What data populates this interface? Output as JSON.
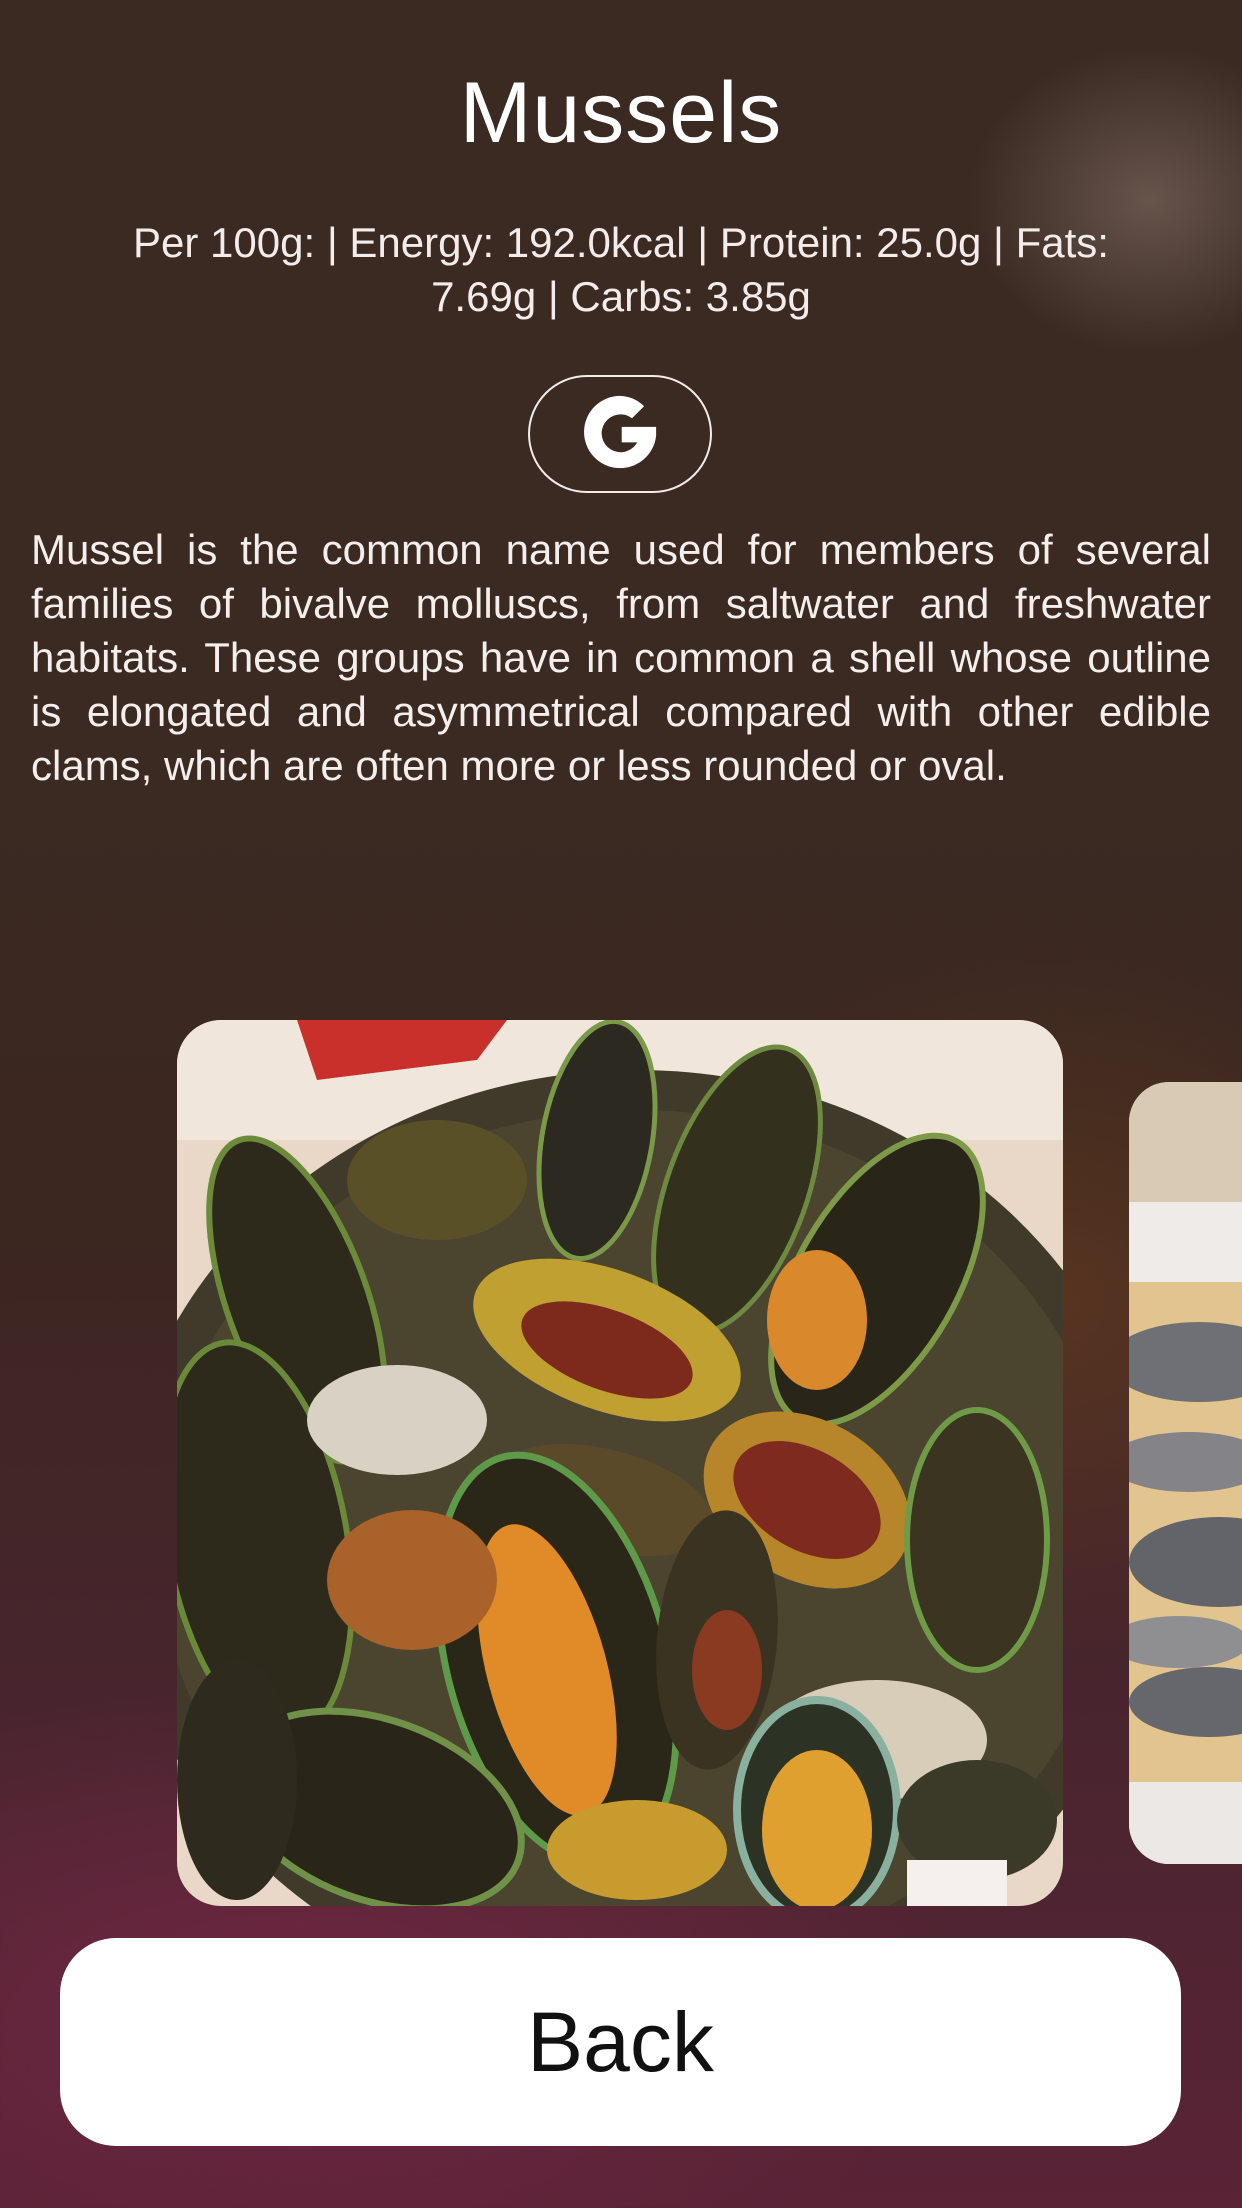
{
  "food": {
    "title": "Mussels",
    "nutrition_line": "Per 100g: | Energy: 192.0kcal | Protein: 25.0g | Fats: 7.69g | Carbs: 3.85g",
    "description": "Mussel is the common name used for members of several families of bivalve molluscs, from saltwater and freshwater habitats. These groups have in common a shell whose outline is elongated and asymmetrical compared with other edible clams, which are often more or less rounded or oval."
  },
  "search": {
    "icon": "google-icon"
  },
  "gallery": {
    "images": [
      {
        "icon": "mussels-dish-photo"
      },
      {
        "icon": "mussels-plate-photo"
      }
    ]
  },
  "actions": {
    "back_label": "Back"
  }
}
